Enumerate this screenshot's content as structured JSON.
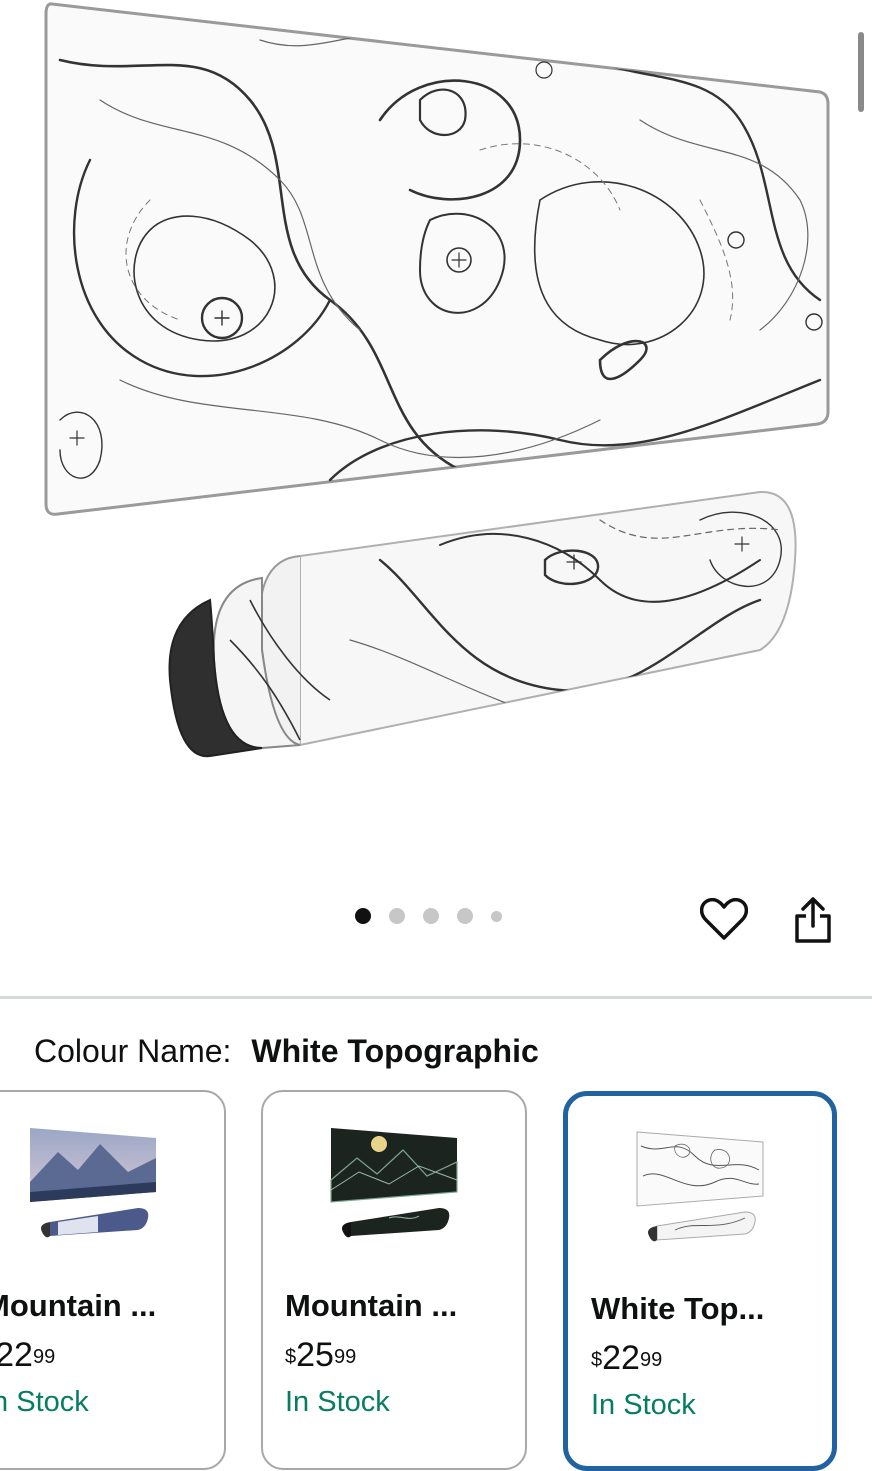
{
  "gallery": {
    "dots_total": 5,
    "active_dot": 0,
    "favourite_icon": "heart-outline-icon",
    "share_icon": "share-icon"
  },
  "colour": {
    "label": "Colour Name:",
    "value": "White Topographic"
  },
  "variants": [
    {
      "name": "Mountain ...",
      "currency": "$",
      "whole": "22",
      "cents": "99",
      "stock": "In Stock",
      "selected": false
    },
    {
      "name": "Mountain ...",
      "currency": "$",
      "whole": "25",
      "cents": "99",
      "stock": "In Stock",
      "selected": false
    },
    {
      "name": "White Top...",
      "currency": "$",
      "whole": "22",
      "cents": "99",
      "stock": "In Stock",
      "selected": true
    }
  ],
  "colors": {
    "selected_border": "#2162a1",
    "stock_green": "#067d62",
    "divider": "#d5d9d9"
  }
}
